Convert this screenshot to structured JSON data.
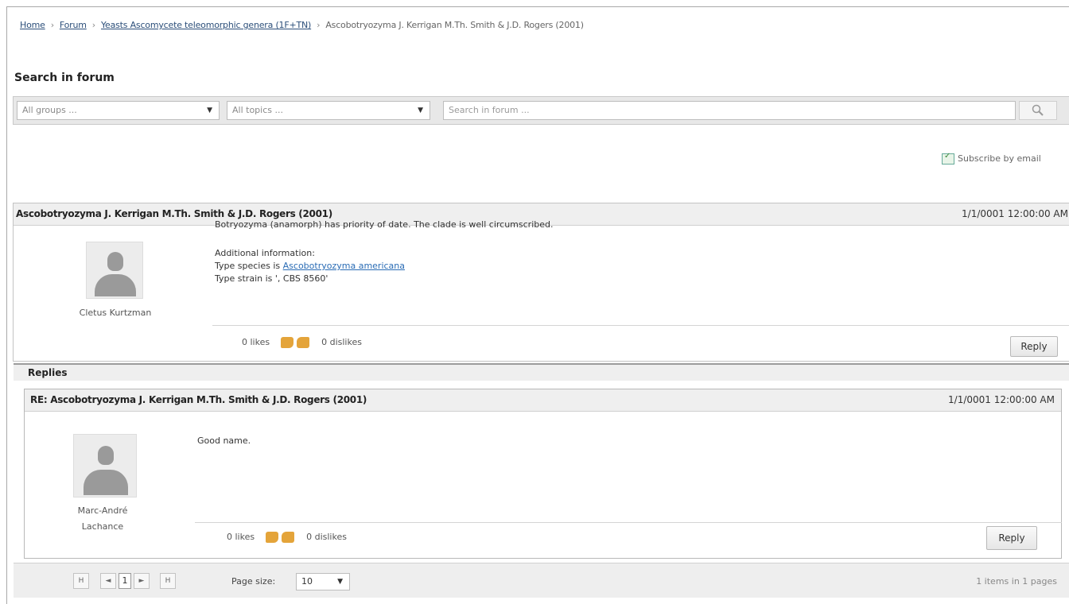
{
  "breadcrumb": {
    "home": "Home",
    "forum": "Forum",
    "group": "Yeasts Ascomycete teleomorphic genera (1F+TN)",
    "current": "Ascobotryozyma J. Kerrigan M.Th. Smith & J.D. Rogers (2001)"
  },
  "search": {
    "title": "Search in forum",
    "groups_value": "All groups ...",
    "topics_value": "All topics ...",
    "placeholder": "Search in forum ...",
    "button_icon": "magnifier-icon"
  },
  "subscribe_label": "Subscribe by email",
  "post": {
    "title": "Ascobotryozyma J. Kerrigan M.Th. Smith & J.D. Rogers (2001)",
    "date": "1/1/0001 12:00:00 AM",
    "author": "Cletus Kurtzman",
    "text": "Botryozyma (anamorph) has priority of date. The clade is well circumscribed.",
    "additional_label": "Additional information:",
    "type_species_prefix": "Type species is ",
    "type_species_link": "Ascobotryozyma americana",
    "type_strain": "Type strain is ', CBS 8560'",
    "likes": "0 likes",
    "dislikes": "0 dislikes",
    "reply_label": "Reply"
  },
  "replies": {
    "header": "Replies",
    "items": [
      {
        "title": "RE: Ascobotryozyma J. Kerrigan M.Th. Smith & J.D. Rogers (2001)",
        "date": "1/1/0001 12:00:00 AM",
        "author_line1": "Marc-André",
        "author_line2": "Lachance",
        "text": "Good name.",
        "likes": "0 likes",
        "dislikes": "0 dislikes",
        "reply_label": "Reply"
      }
    ]
  },
  "pager": {
    "current_page": "1",
    "first": "H",
    "prev": "◄",
    "next": "►",
    "last": "H",
    "page_size_label": "Page size:",
    "page_size_value": "10",
    "info": "1 items in 1 pages"
  },
  "colors": {
    "link": "#2c4f7a",
    "content_link": "#2a6cb5",
    "thumb": "#e4a43a",
    "header_bg": "#efefef"
  }
}
